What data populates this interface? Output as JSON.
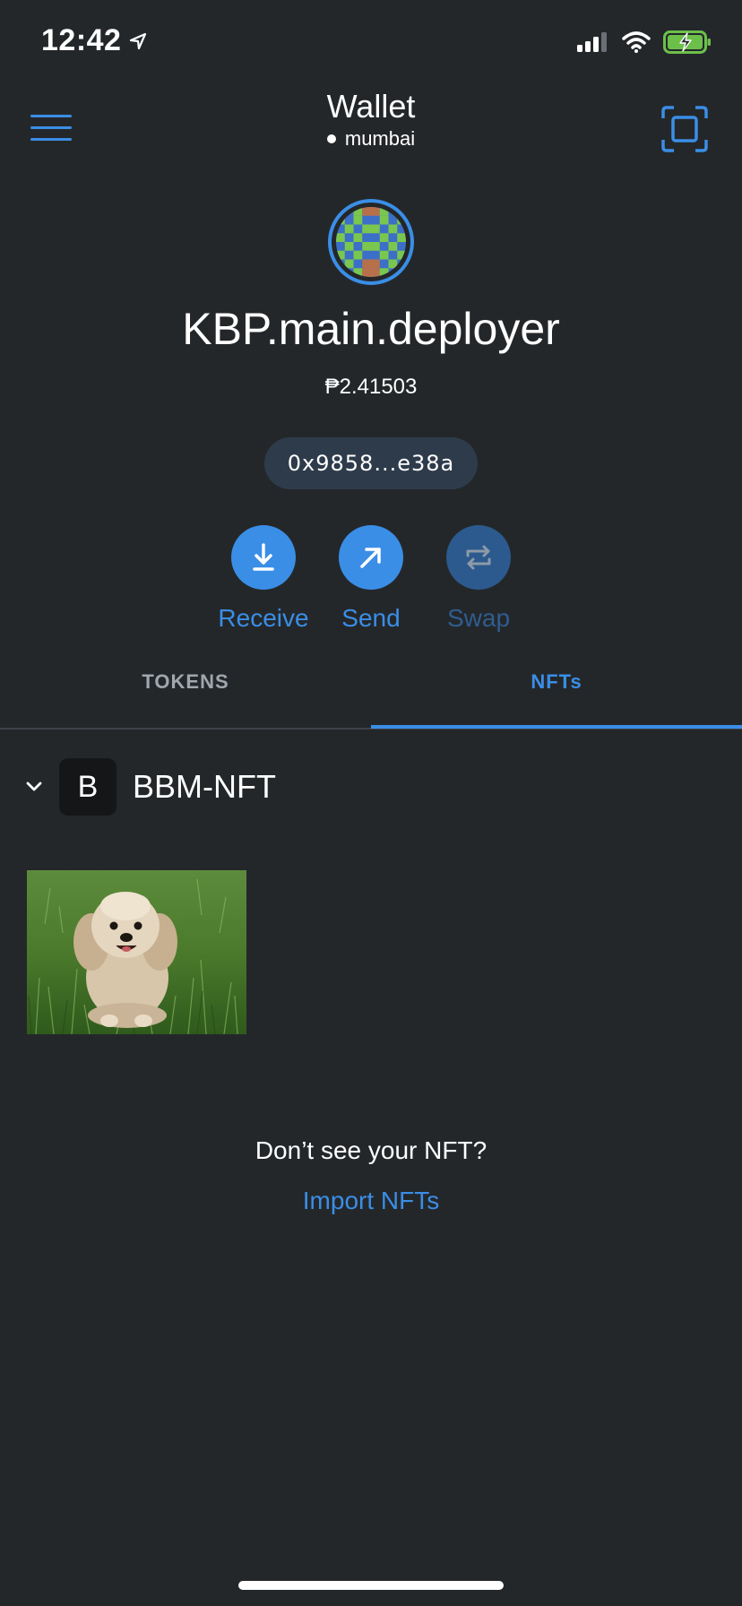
{
  "status_bar": {
    "time": "12:42"
  },
  "header": {
    "title": "Wallet",
    "network": "mumbai"
  },
  "account": {
    "name": "KBP.main.deployer",
    "balance": "₱2.41503",
    "address": "0x9858...e38a"
  },
  "actions": {
    "receive": "Receive",
    "send": "Send",
    "swap": "Swap"
  },
  "tabs": {
    "tokens": "TOKENS",
    "nfts": "NFTs",
    "active": "nfts"
  },
  "collection": {
    "badge_letter": "B",
    "name": "BBM-NFT"
  },
  "empty_prompt": {
    "text": "Don’t see your NFT?",
    "link": "Import NFTs"
  },
  "colors": {
    "background": "#24272a",
    "accent": "#3a8ee6",
    "pill": "#2e3b4b"
  }
}
